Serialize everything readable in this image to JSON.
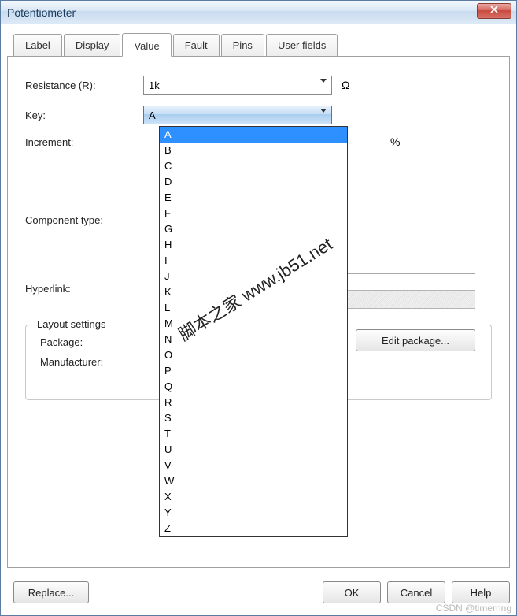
{
  "window": {
    "title": "Potentiometer"
  },
  "tabs": {
    "items": [
      {
        "label": "Label"
      },
      {
        "label": "Display"
      },
      {
        "label": "Value"
      },
      {
        "label": "Fault"
      },
      {
        "label": "Pins"
      },
      {
        "label": "User fields"
      }
    ],
    "active_index": 2
  },
  "fields": {
    "resistance": {
      "label": "Resistance (R):",
      "value": "1k",
      "unit": "Ω"
    },
    "key": {
      "label": "Key:",
      "value": "A"
    },
    "increment": {
      "label": "Increment:",
      "unit": "%"
    },
    "component_type": {
      "label": "Component type:"
    },
    "hyperlink": {
      "label": "Hyperlink:"
    }
  },
  "layout": {
    "legend": "Layout settings",
    "package": {
      "label": "Package:"
    },
    "manufacturer": {
      "label": "Manufacturer:"
    },
    "edit_package": "Edit package..."
  },
  "key_options": [
    "A",
    "B",
    "C",
    "D",
    "E",
    "F",
    "G",
    "H",
    "I",
    "J",
    "K",
    "L",
    "M",
    "N",
    "O",
    "P",
    "Q",
    "R",
    "S",
    "T",
    "U",
    "V",
    "W",
    "X",
    "Y",
    "Z"
  ],
  "key_selected_index": 0,
  "buttons": {
    "replace": "Replace...",
    "ok": "OK",
    "cancel": "Cancel",
    "help": "Help"
  },
  "watermark": "脚本之家 www.jb51.net",
  "csdn": "CSDN @timerring"
}
